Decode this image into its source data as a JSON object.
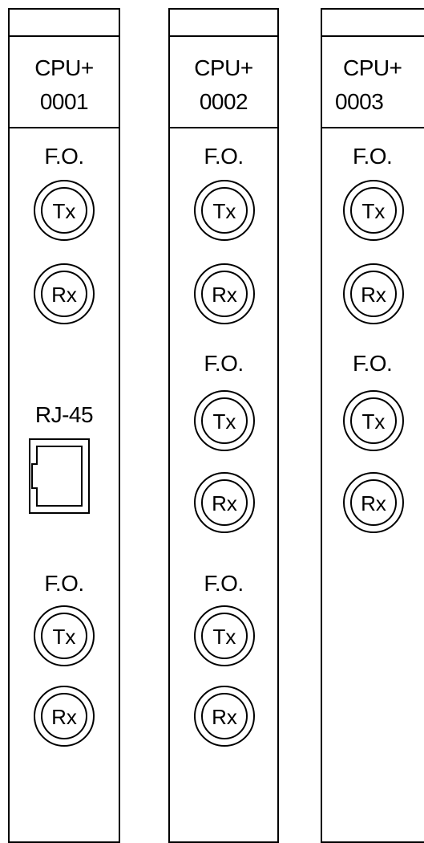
{
  "modules": [
    {
      "name_line1": "CPU+",
      "name_line2": "0001",
      "fo_label_1": "F.O.",
      "tx_1": "Tx",
      "rx_1": "Rx",
      "rj45_label": "RJ-45",
      "fo_label_2": "F.O.",
      "tx_2": "Tx",
      "rx_2": "Rx"
    },
    {
      "name_line1": "CPU+",
      "name_line2": "0002",
      "fo_label_1": "F.O.",
      "tx_1": "Tx",
      "rx_1": "Rx",
      "fo_label_2": "F.O.",
      "tx_2": "Tx",
      "rx_2": "Rx",
      "fo_label_3": "F.O.",
      "tx_3": "Tx",
      "rx_3": "Rx"
    },
    {
      "name_line1": "CPU+",
      "name_line2": "0003",
      "fo_label_1": "F.O.",
      "tx_1": "Tx",
      "rx_1": "Rx",
      "fo_label_2": "F.O.",
      "tx_2": "Tx",
      "rx_2": "Rx"
    }
  ]
}
